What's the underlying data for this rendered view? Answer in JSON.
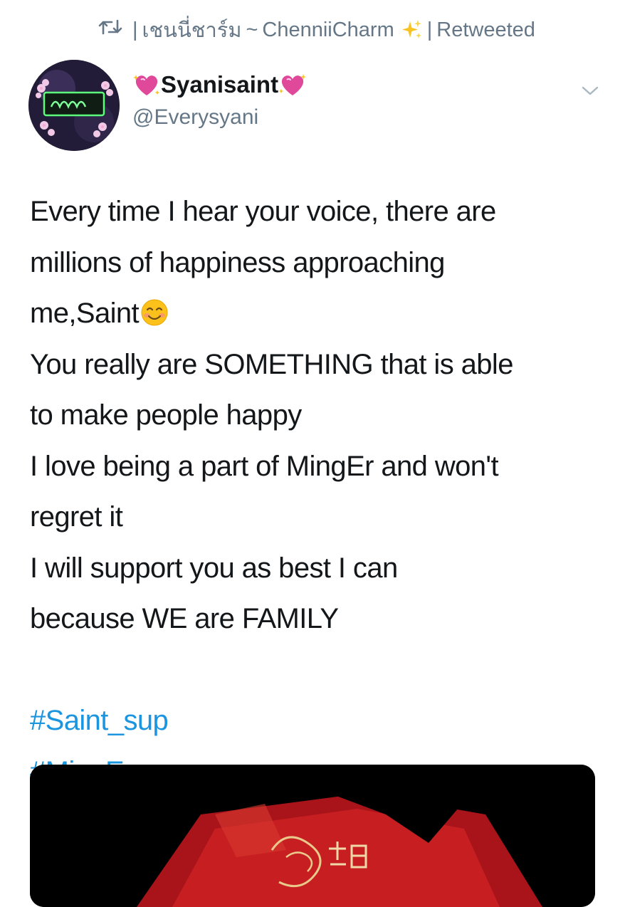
{
  "retweet": {
    "icon": "retweet-icon",
    "prefix": "|",
    "thai_name": "เชนนี่ชาร์ม",
    "tilde": "~",
    "english_name": "ChenniiCharm",
    "separator": "|",
    "label": "Retweeted"
  },
  "author": {
    "display_name": "Syanisaint",
    "handle": "@Everysyani",
    "name_emoji": "sparkling-heart-emoji"
  },
  "tweet": {
    "lines": [
      "Every time I hear your voice, there are",
      "millions of happiness approaching",
      "me,Saint",
      "You really are SOMETHING that is able",
      "to make people happy",
      "I love being a part of MingEr and won't",
      "regret it",
      "I will support you as best I can",
      "because WE are FAMILY"
    ],
    "hashtags": [
      "#Saint_sup",
      "#MingEr"
    ]
  },
  "colors": {
    "text": "#14171a",
    "secondary": "#657786",
    "link": "#1b95e0",
    "heart": "#e0489a"
  }
}
